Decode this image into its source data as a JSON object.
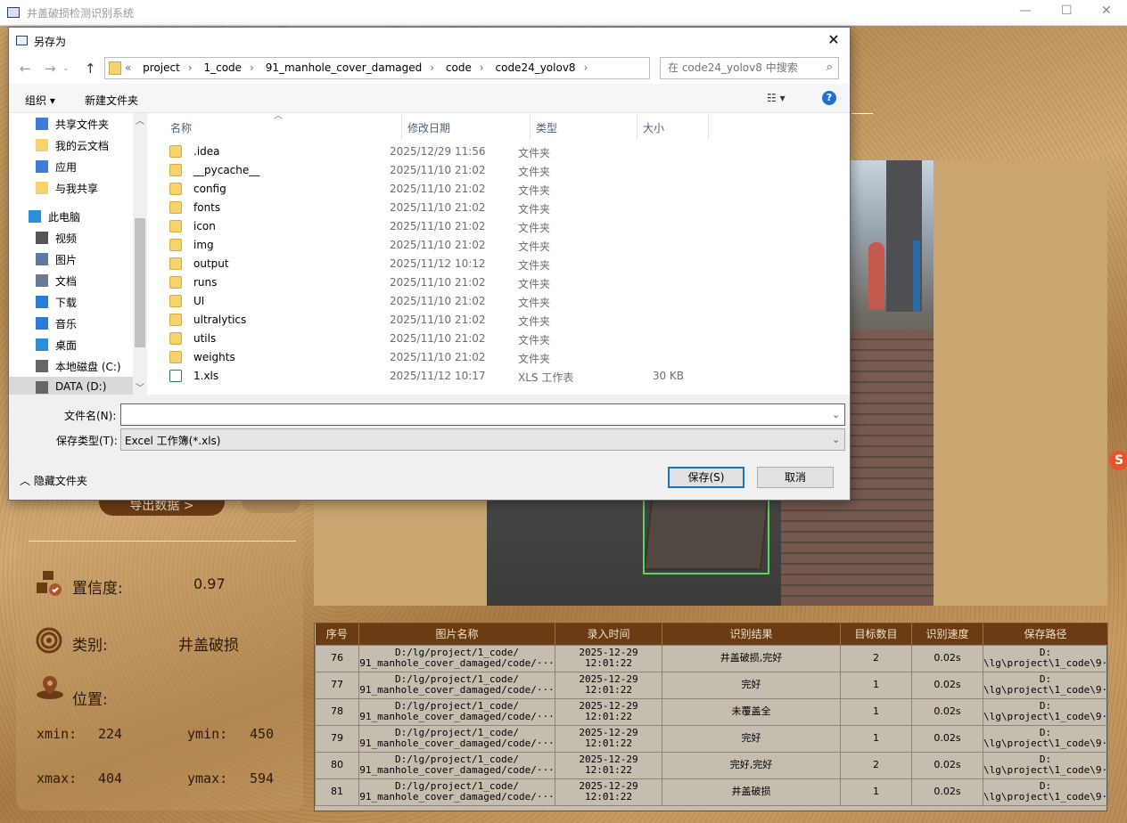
{
  "app": {
    "title": "井盖破损检测识别系统"
  },
  "dialog": {
    "title": "另存为",
    "nav_prefix": "«",
    "path": [
      "project",
      "1_code",
      "91_manhole_cover_damaged",
      "code",
      "code24_yolov8"
    ],
    "search_placeholder": "在 code24_yolov8 中搜索",
    "toolbar": {
      "organize": "组织 ▾",
      "new_folder": "新建文件夹"
    },
    "sidebar": [
      {
        "label": "共享文件夹",
        "icon": "share-icon"
      },
      {
        "label": "我的云文档",
        "icon": "folder-icon"
      },
      {
        "label": "应用",
        "icon": "apps-icon"
      },
      {
        "label": "与我共享",
        "icon": "folder-icon"
      },
      {
        "label": "此电脑",
        "icon": "computer-icon"
      },
      {
        "label": "视频",
        "icon": "video-icon"
      },
      {
        "label": "图片",
        "icon": "picture-icon"
      },
      {
        "label": "文档",
        "icon": "document-icon"
      },
      {
        "label": "下载",
        "icon": "download-icon"
      },
      {
        "label": "音乐",
        "icon": "music-icon"
      },
      {
        "label": "桌面",
        "icon": "desktop-icon"
      },
      {
        "label": "本地磁盘 (C:)",
        "icon": "drive-icon"
      },
      {
        "label": "DATA (D:)",
        "icon": "drive-icon"
      }
    ],
    "columns": {
      "name": "名称",
      "date": "修改日期",
      "type": "类型",
      "size": "大小"
    },
    "files": [
      {
        "name": ".idea",
        "date": "2025/12/29 11:56",
        "type": "文件夹",
        "size": ""
      },
      {
        "name": "__pycache__",
        "date": "2025/11/10 21:02",
        "type": "文件夹",
        "size": ""
      },
      {
        "name": "config",
        "date": "2025/11/10 21:02",
        "type": "文件夹",
        "size": ""
      },
      {
        "name": "fonts",
        "date": "2025/11/10 21:02",
        "type": "文件夹",
        "size": ""
      },
      {
        "name": "icon",
        "date": "2025/11/10 21:02",
        "type": "文件夹",
        "size": ""
      },
      {
        "name": "img",
        "date": "2025/11/10 21:02",
        "type": "文件夹",
        "size": ""
      },
      {
        "name": "output",
        "date": "2025/11/12 10:12",
        "type": "文件夹",
        "size": ""
      },
      {
        "name": "runs",
        "date": "2025/11/10 21:02",
        "type": "文件夹",
        "size": ""
      },
      {
        "name": "UI",
        "date": "2025/11/10 21:02",
        "type": "文件夹",
        "size": ""
      },
      {
        "name": "ultralytics",
        "date": "2025/11/10 21:02",
        "type": "文件夹",
        "size": ""
      },
      {
        "name": "utils",
        "date": "2025/11/10 21:02",
        "type": "文件夹",
        "size": ""
      },
      {
        "name": "weights",
        "date": "2025/11/10 21:02",
        "type": "文件夹",
        "size": ""
      },
      {
        "name": "1.xls",
        "date": "2025/11/12 10:17",
        "type": "XLS 工作表",
        "size": "30 KB"
      }
    ],
    "filename_label": "文件名(N):",
    "filename_value": "",
    "filetype_label": "保存类型(T):",
    "filetype_value": "Excel 工作簿(*.xls)",
    "hide_folders": "隐藏文件夹",
    "save": "保存(S)",
    "cancel": "取消"
  },
  "left_panel": {
    "export": "导出数据 >",
    "confidence_label": "置信度:",
    "confidence_value": "0.97",
    "class_label": "类别:",
    "class_value": "井盖破损",
    "position_label": "位置:",
    "xmin_label": "xmin:",
    "xmin": "224",
    "ymin_label": "ymin:",
    "ymin": "450",
    "xmax_label": "xmax:",
    "xmax": "404",
    "ymax_label": "ymax:",
    "ymax": "594"
  },
  "table": {
    "headers": [
      "序号",
      "图片名称",
      "录入时间",
      "识别结果",
      "目标数目",
      "识别速度",
      "保存路径"
    ],
    "rows": [
      {
        "id": "76",
        "name": "D:/lg/project/1_code/\n91_manhole_cover_damaged/code/···",
        "time": "2025-12-29\n12:01:22",
        "result": "井盖破损,完好",
        "count": "2",
        "speed": "0.02s",
        "path": "D:\n\\lg\\project\\1_code\\9···"
      },
      {
        "id": "77",
        "name": "D:/lg/project/1_code/\n91_manhole_cover_damaged/code/···",
        "time": "2025-12-29\n12:01:22",
        "result": "完好",
        "count": "1",
        "speed": "0.02s",
        "path": "D:\n\\lg\\project\\1_code\\9···"
      },
      {
        "id": "78",
        "name": "D:/lg/project/1_code/\n91_manhole_cover_damaged/code/···",
        "time": "2025-12-29\n12:01:22",
        "result": "未覆盖全",
        "count": "1",
        "speed": "0.02s",
        "path": "D:\n\\lg\\project\\1_code\\9···"
      },
      {
        "id": "79",
        "name": "D:/lg/project/1_code/\n91_manhole_cover_damaged/code/···",
        "time": "2025-12-29\n12:01:22",
        "result": "完好",
        "count": "1",
        "speed": "0.02s",
        "path": "D:\n\\lg\\project\\1_code\\9···"
      },
      {
        "id": "80",
        "name": "D:/lg/project/1_code/\n91_manhole_cover_damaged/code/···",
        "time": "2025-12-29\n12:01:22",
        "result": "完好,完好",
        "count": "2",
        "speed": "0.02s",
        "path": "D:\n\\lg\\project\\1_code\\9···"
      },
      {
        "id": "81",
        "name": "D:/lg/project/1_code/\n91_manhole_cover_damaged/code/···",
        "time": "2025-12-29\n12:01:22",
        "result": "井盖破损",
        "count": "1",
        "speed": "0.02s",
        "path": "D:\n\\lg\\project\\1_code\\9···"
      }
    ]
  },
  "colors": {
    "accent": "#6b3c14",
    "dialog_blue": "#1a73c0",
    "detect_box": "#5fd35f"
  }
}
